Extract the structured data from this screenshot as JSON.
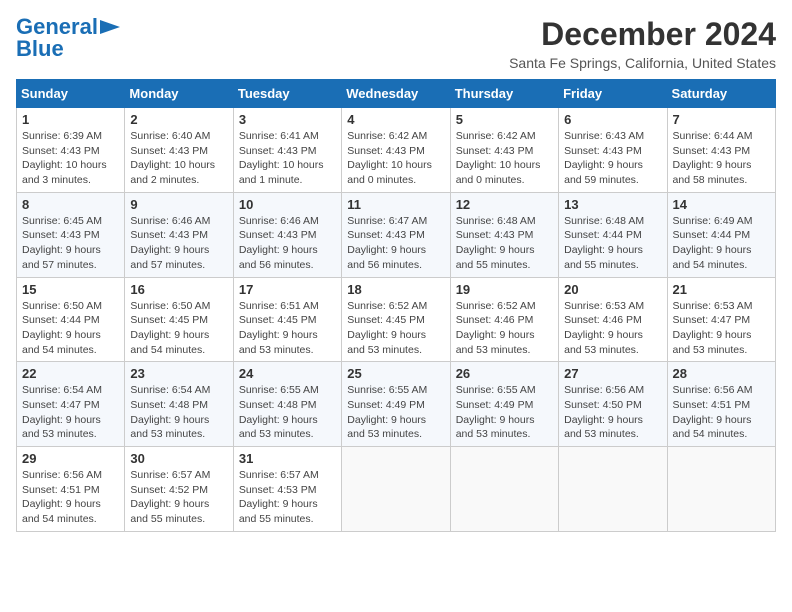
{
  "logo": {
    "line1": "General",
    "line2": "Blue",
    "icon": "▶"
  },
  "title": "December 2024",
  "location": "Santa Fe Springs, California, United States",
  "days_of_week": [
    "Sunday",
    "Monday",
    "Tuesday",
    "Wednesday",
    "Thursday",
    "Friday",
    "Saturday"
  ],
  "weeks": [
    [
      {
        "day": 1,
        "info": "Sunrise: 6:39 AM\nSunset: 4:43 PM\nDaylight: 10 hours\nand 3 minutes."
      },
      {
        "day": 2,
        "info": "Sunrise: 6:40 AM\nSunset: 4:43 PM\nDaylight: 10 hours\nand 2 minutes."
      },
      {
        "day": 3,
        "info": "Sunrise: 6:41 AM\nSunset: 4:43 PM\nDaylight: 10 hours\nand 1 minute."
      },
      {
        "day": 4,
        "info": "Sunrise: 6:42 AM\nSunset: 4:43 PM\nDaylight: 10 hours\nand 0 minutes."
      },
      {
        "day": 5,
        "info": "Sunrise: 6:42 AM\nSunset: 4:43 PM\nDaylight: 10 hours\nand 0 minutes."
      },
      {
        "day": 6,
        "info": "Sunrise: 6:43 AM\nSunset: 4:43 PM\nDaylight: 9 hours\nand 59 minutes."
      },
      {
        "day": 7,
        "info": "Sunrise: 6:44 AM\nSunset: 4:43 PM\nDaylight: 9 hours\nand 58 minutes."
      }
    ],
    [
      {
        "day": 8,
        "info": "Sunrise: 6:45 AM\nSunset: 4:43 PM\nDaylight: 9 hours\nand 57 minutes."
      },
      {
        "day": 9,
        "info": "Sunrise: 6:46 AM\nSunset: 4:43 PM\nDaylight: 9 hours\nand 57 minutes."
      },
      {
        "day": 10,
        "info": "Sunrise: 6:46 AM\nSunset: 4:43 PM\nDaylight: 9 hours\nand 56 minutes."
      },
      {
        "day": 11,
        "info": "Sunrise: 6:47 AM\nSunset: 4:43 PM\nDaylight: 9 hours\nand 56 minutes."
      },
      {
        "day": 12,
        "info": "Sunrise: 6:48 AM\nSunset: 4:43 PM\nDaylight: 9 hours\nand 55 minutes."
      },
      {
        "day": 13,
        "info": "Sunrise: 6:48 AM\nSunset: 4:44 PM\nDaylight: 9 hours\nand 55 minutes."
      },
      {
        "day": 14,
        "info": "Sunrise: 6:49 AM\nSunset: 4:44 PM\nDaylight: 9 hours\nand 54 minutes."
      }
    ],
    [
      {
        "day": 15,
        "info": "Sunrise: 6:50 AM\nSunset: 4:44 PM\nDaylight: 9 hours\nand 54 minutes."
      },
      {
        "day": 16,
        "info": "Sunrise: 6:50 AM\nSunset: 4:45 PM\nDaylight: 9 hours\nand 54 minutes."
      },
      {
        "day": 17,
        "info": "Sunrise: 6:51 AM\nSunset: 4:45 PM\nDaylight: 9 hours\nand 53 minutes."
      },
      {
        "day": 18,
        "info": "Sunrise: 6:52 AM\nSunset: 4:45 PM\nDaylight: 9 hours\nand 53 minutes."
      },
      {
        "day": 19,
        "info": "Sunrise: 6:52 AM\nSunset: 4:46 PM\nDaylight: 9 hours\nand 53 minutes."
      },
      {
        "day": 20,
        "info": "Sunrise: 6:53 AM\nSunset: 4:46 PM\nDaylight: 9 hours\nand 53 minutes."
      },
      {
        "day": 21,
        "info": "Sunrise: 6:53 AM\nSunset: 4:47 PM\nDaylight: 9 hours\nand 53 minutes."
      }
    ],
    [
      {
        "day": 22,
        "info": "Sunrise: 6:54 AM\nSunset: 4:47 PM\nDaylight: 9 hours\nand 53 minutes."
      },
      {
        "day": 23,
        "info": "Sunrise: 6:54 AM\nSunset: 4:48 PM\nDaylight: 9 hours\nand 53 minutes."
      },
      {
        "day": 24,
        "info": "Sunrise: 6:55 AM\nSunset: 4:48 PM\nDaylight: 9 hours\nand 53 minutes."
      },
      {
        "day": 25,
        "info": "Sunrise: 6:55 AM\nSunset: 4:49 PM\nDaylight: 9 hours\nand 53 minutes."
      },
      {
        "day": 26,
        "info": "Sunrise: 6:55 AM\nSunset: 4:49 PM\nDaylight: 9 hours\nand 53 minutes."
      },
      {
        "day": 27,
        "info": "Sunrise: 6:56 AM\nSunset: 4:50 PM\nDaylight: 9 hours\nand 53 minutes."
      },
      {
        "day": 28,
        "info": "Sunrise: 6:56 AM\nSunset: 4:51 PM\nDaylight: 9 hours\nand 54 minutes."
      }
    ],
    [
      {
        "day": 29,
        "info": "Sunrise: 6:56 AM\nSunset: 4:51 PM\nDaylight: 9 hours\nand 54 minutes."
      },
      {
        "day": 30,
        "info": "Sunrise: 6:57 AM\nSunset: 4:52 PM\nDaylight: 9 hours\nand 55 minutes."
      },
      {
        "day": 31,
        "info": "Sunrise: 6:57 AM\nSunset: 4:53 PM\nDaylight: 9 hours\nand 55 minutes."
      },
      null,
      null,
      null,
      null
    ]
  ]
}
